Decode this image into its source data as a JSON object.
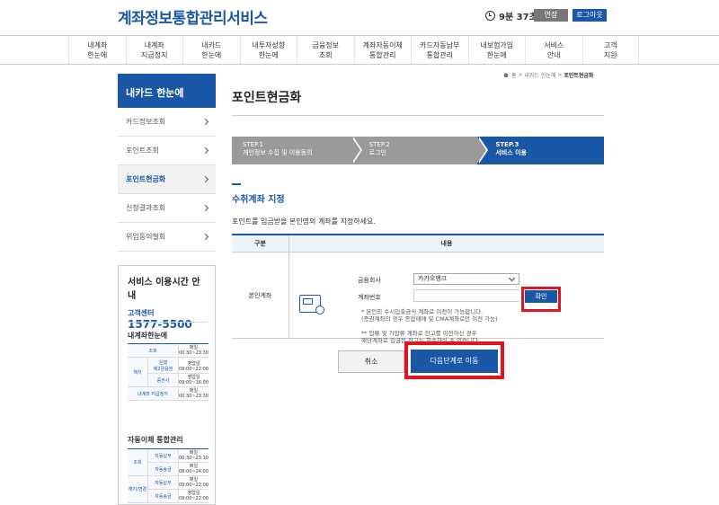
{
  "header": {
    "logo": "계좌정보통합관리서비스",
    "timer": "9분 37초",
    "extend_label": "연장",
    "logout_label": "로그아웃"
  },
  "gnb": [
    "내계좌\n한눈에",
    "내계좌\n지급정지",
    "내카드\n한눈에",
    "내투자성향\n한눈에",
    "금융정보\n조회",
    "계좌자동이체\n통합관리",
    "카드자동납부\n통합관리",
    "내보험가입\n한눈에",
    "서비스\n안내",
    "고객\n지원"
  ],
  "breadcrumb": {
    "home": "홈",
    "sep1": ">",
    "item1": "내카드 한눈에",
    "sep2": ">",
    "current": "포인트현금화"
  },
  "lnb": {
    "title": "내카드 한눈에",
    "items": [
      "카드정보조회",
      "포인트조회",
      "포인트현금화",
      "신청결과조회",
      "위임동의철회"
    ]
  },
  "main": {
    "title": "포인트현금화",
    "steps": [
      {
        "num": "STEP.1",
        "label": "개인정보 수집 및 이용동의"
      },
      {
        "num": "STEP.2",
        "label": "로그인"
      },
      {
        "num": "STEP.3",
        "label": "서비스 이용"
      }
    ],
    "section_title": "수취계좌 지정",
    "description": "포인트를 입금받을 본인명의 계좌를 지정하세요.",
    "table": {
      "col1": "구분",
      "col2": "내용",
      "row_label": "본인계좌",
      "bank_label": "금융회사",
      "bank_value": "카카오뱅크",
      "account_label": "계좌번호",
      "account_value": "",
      "confirm_label": "확인",
      "note1": "* 본인의 수시입출금식 계좌로 이전이 가능합니다.\n  (증권계좌의 경우 종합매매 및 CMA계좌로만 이전 가능)",
      "note2": "** 압류 및 가압류 계좌로 잔고를 이전하신 경우\n    해당계좌로 입금된 잔고는 회수하실 수 없습니다."
    },
    "cancel_label": "취소",
    "next_label": "다음단계로 이동"
  },
  "side": {
    "title": "서비스 이용시간 안내",
    "center_label": "고객센터",
    "phone": "1577-5500",
    "sec1": "내계좌한눈에",
    "t1": {
      "r1c1": "조회",
      "r1c2": "매일\n00:30~23:30",
      "r2c0": "해지",
      "r2c1": "은행",
      "r2c1b": "제2금융권",
      "r2c2": "영업일\n09:00~22:00",
      "r3c1": "증권사",
      "r3c2": "영업일\n09:00~16:00",
      "r4c1": "내계좌 지급정지",
      "r4c2": "매일\n00:30~23:30"
    },
    "sec2": "자동이체 통합관리",
    "t2": {
      "r1c0": "조회",
      "r1c1": "자동납부",
      "r1c2": "매일\n00:30~23:30",
      "r2c1": "자동송금",
      "r2c2": "매일\n08:00~24:00",
      "r3c0": "해지/변경",
      "r3c1": "자동납부",
      "r3c2": "매일\n09:00~22:00",
      "r4c1": "자동송금",
      "r4c2": "영업일\n09:00~22:00"
    }
  }
}
